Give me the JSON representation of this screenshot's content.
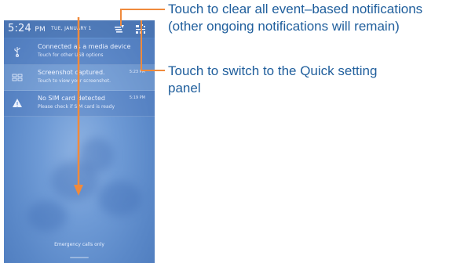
{
  "status_bar": {
    "time": "5:24",
    "ampm": "PM",
    "date": "TUE, JANUARY 1",
    "clear_icon": "clear-all-icon",
    "quick_settings_icon": "quick-settings-icon"
  },
  "notifications": [
    {
      "icon": "usb-icon",
      "title": "Connected as a media device",
      "subtitle": "Touch for other USB options",
      "time": ""
    },
    {
      "icon": "screenshot-icon",
      "title": "Screenshot captured.",
      "subtitle": "Touch to view your screenshot.",
      "time": "5:23 PM"
    },
    {
      "icon": "warning-icon",
      "title": "No SIM card detected",
      "subtitle": "Please check if SIM card is ready",
      "time": "5:19 PM"
    }
  ],
  "footer": {
    "emergency": "Emergency calls only"
  },
  "callouts": {
    "clear_line1": "Touch to clear all event–based notifications",
    "clear_line2": "(other ongoing notifications will remain)",
    "quick_line1": "Touch to switch to the Quick setting",
    "quick_line2": "panel"
  },
  "colors": {
    "accent": "#f08a3c",
    "callout_text": "#1f5e9c",
    "panel": "#6f9bd6"
  }
}
